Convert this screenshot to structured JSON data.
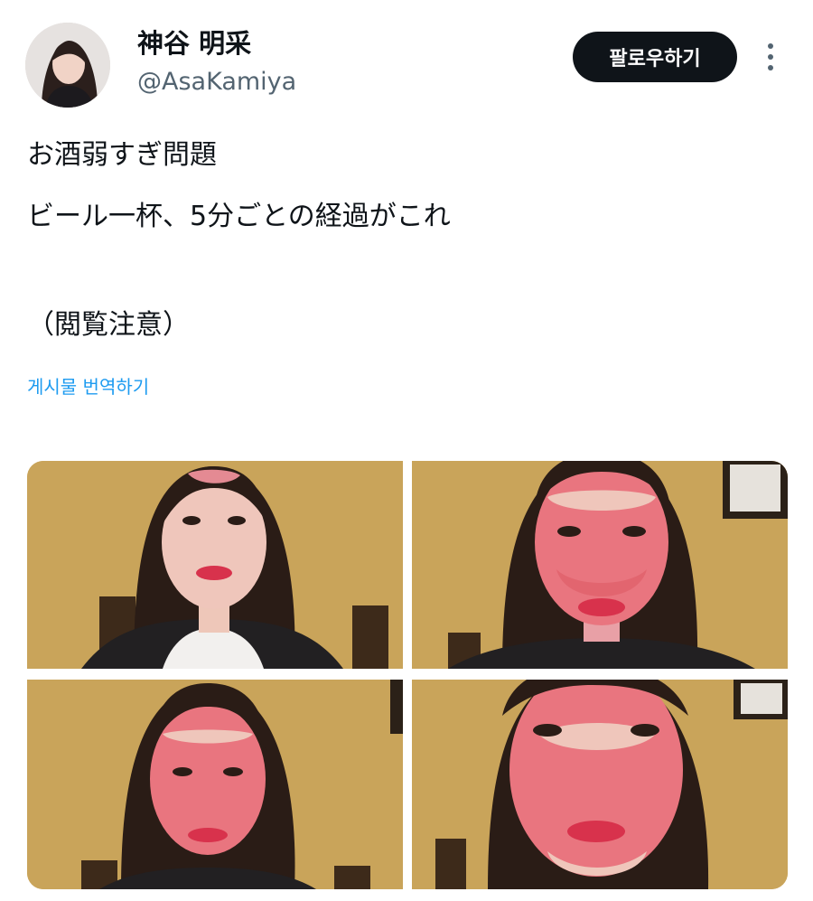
{
  "author": {
    "display_name": "神谷 明采",
    "handle": "@AsaKamiya",
    "avatar_icon": "profile-photo"
  },
  "header": {
    "follow_label": "팔로우하기",
    "more_icon": "more-vertical-icon"
  },
  "tweet": {
    "lines": [
      "お酒弱すぎ問題",
      "ビール一杯、5分ごとの経過がこれ",
      "（閲覧注意）"
    ],
    "translate_label": "게시물 번역하기"
  },
  "media": {
    "photo_count": 4,
    "photos": [
      "photo-1",
      "photo-2",
      "photo-3",
      "photo-4"
    ]
  },
  "colors": {
    "accent": "#1d9bf0",
    "button_bg": "#0f1419",
    "handle_gray": "#536471"
  }
}
